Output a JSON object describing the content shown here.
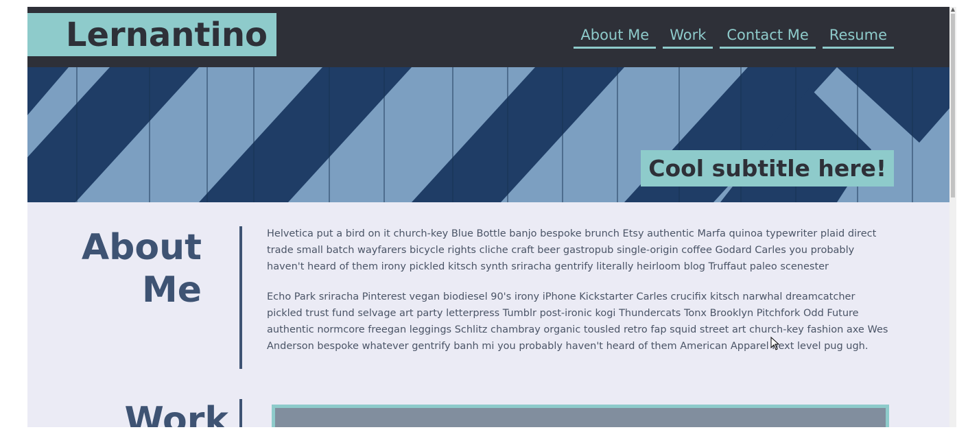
{
  "header": {
    "logo": "Lernantino",
    "nav": [
      "About Me",
      "Work",
      "Contact Me",
      "Resume"
    ]
  },
  "hero": {
    "subtitle": "Cool subtitle here!"
  },
  "about": {
    "title_line1": "About",
    "title_line2": "Me",
    "paragraphs": [
      "Helvetica put a bird on it church-key Blue Bottle banjo bespoke brunch Etsy authentic Marfa quinoa typewriter plaid direct trade small batch wayfarers bicycle rights cliche craft beer gastropub single-origin coffee Godard Carles you probably haven't heard of them irony pickled kitsch synth sriracha gentrify literally heirloom blog Truffaut paleo scenester",
      "Echo Park sriracha Pinterest vegan biodiesel 90's irony iPhone Kickstarter Carles crucifix kitsch narwhal dreamcatcher pickled trust fund selvage art party letterpress Tumblr post-ironic kogi Thundercats Tonx Brooklyn Pitchfork Odd Future authentic normcore freegan leggings Schlitz chambray organic tousled retro fap squid street art church-key fashion axe Wes Anderson bespoke whatever gentrify banh mi you probably haven't heard of them American Apparel next level pug ugh."
    ]
  },
  "work": {
    "title": "Work"
  },
  "colors": {
    "dark": "#2e3038",
    "accent": "#8ecbcb",
    "heading": "#3e5373",
    "background": "#ebebf5"
  }
}
